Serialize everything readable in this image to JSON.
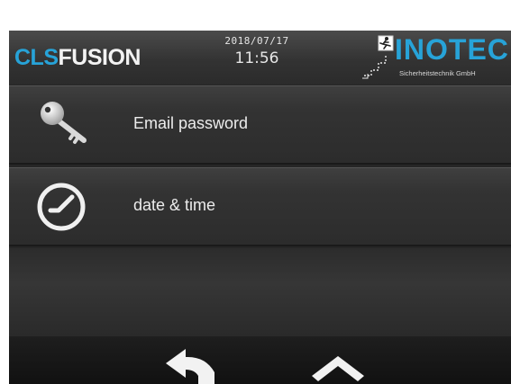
{
  "header": {
    "logo_cls": "CLS",
    "logo_fusion": "FUSION",
    "date": "2018/07/17",
    "time": "11:56",
    "brand_name": "INOTEC",
    "brand_subtitle": "Sicherheitstechnik GmbH"
  },
  "menu": {
    "items": [
      {
        "label": "Email password",
        "icon": "key-icon"
      },
      {
        "label": "date & time",
        "icon": "clock-icon"
      }
    ]
  },
  "bottom_bar": {
    "buttons": [
      {
        "icon": "back-arrow-icon"
      },
      {
        "icon": "home-icon"
      }
    ]
  },
  "colors": {
    "accent": "#27a3d8",
    "background": "#262626",
    "text": "#ececec"
  }
}
